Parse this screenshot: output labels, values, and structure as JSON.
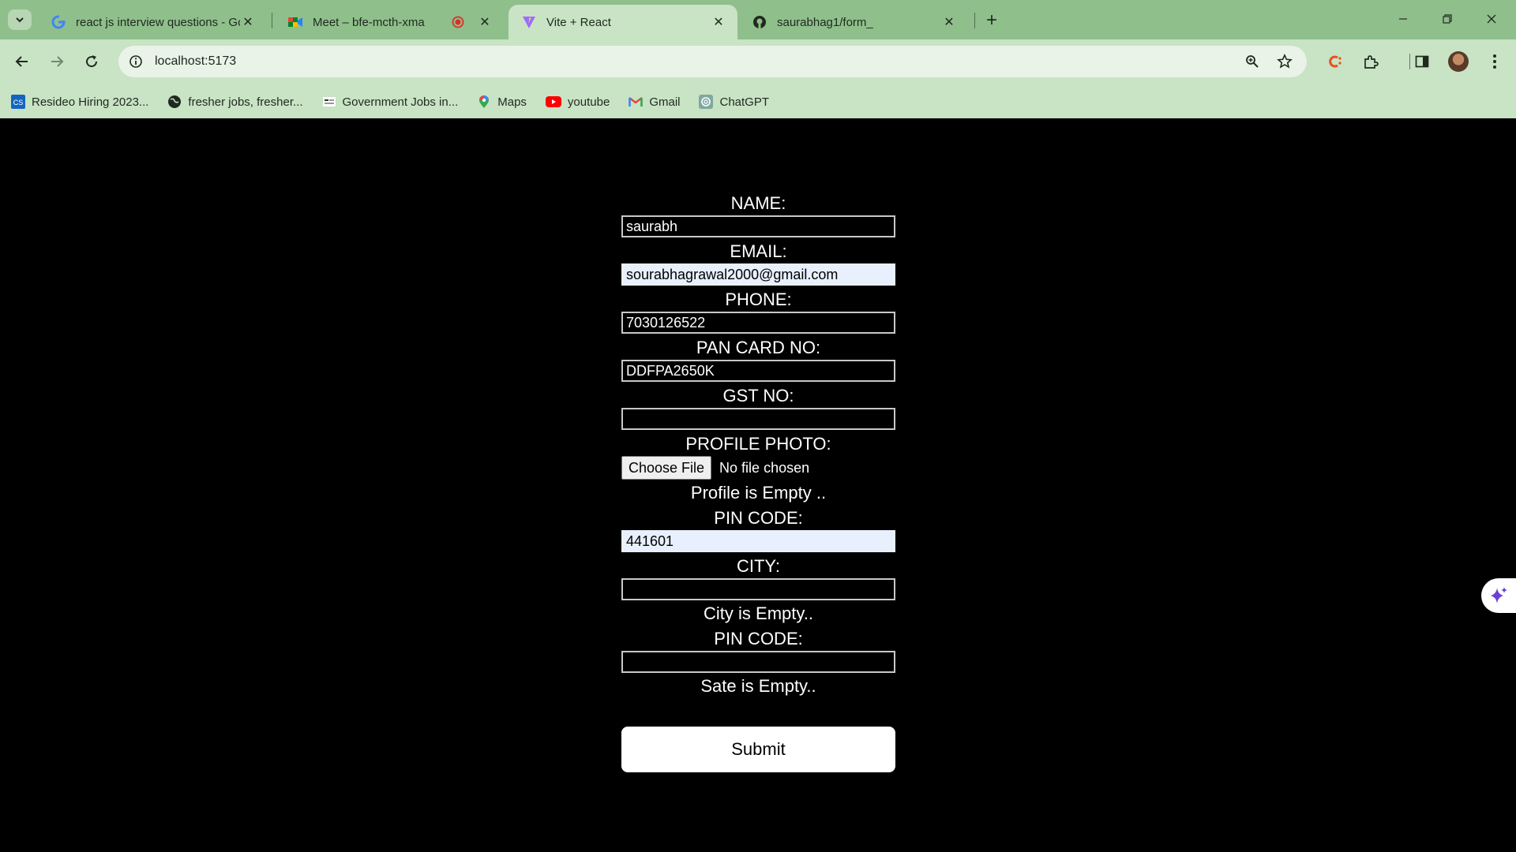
{
  "browser": {
    "tabs": [
      {
        "title": "react js interview questions - Go",
        "icon": "google-icon"
      },
      {
        "title": "Meet – bfe-mcth-xma",
        "icon": "meet-icon"
      },
      {
        "title": "Vite + React",
        "icon": "vite-icon",
        "active": true
      },
      {
        "title": "saurabhag1/form_",
        "icon": "github-icon"
      }
    ],
    "url": "localhost:5173",
    "bookmarks": [
      {
        "label": "Resideo Hiring 2023...",
        "icon": "cs-icon"
      },
      {
        "label": "fresher jobs, fresher...",
        "icon": "globe-icon"
      },
      {
        "label": "Government Jobs in...",
        "icon": "govt-icon"
      },
      {
        "label": "Maps",
        "icon": "maps-icon"
      },
      {
        "label": "youtube",
        "icon": "youtube-icon"
      },
      {
        "label": "Gmail",
        "icon": "gmail-icon"
      },
      {
        "label": "ChatGPT",
        "icon": "chatgpt-icon"
      }
    ]
  },
  "form": {
    "name_label": "NAME:",
    "name_value": "saurabh",
    "email_label": "EMAIL:",
    "email_value": "sourabhagrawal2000@gmail.com",
    "phone_label": "PHONE:",
    "phone_value": "7030126522",
    "pan_label": "PAN CARD NO:",
    "pan_value": "DDFPA2650K",
    "gst_label": "GST NO:",
    "gst_value": "",
    "photo_label": "PROFILE PHOTO:",
    "choose_file": "Choose File",
    "no_file": "No file chosen",
    "profile_error": "Profile is Empty ..",
    "pin_label": "PIN CODE:",
    "pin_value": "441601",
    "city_label": "CITY:",
    "city_value": "",
    "city_error": "City is Empty..",
    "pin2_label": "PIN CODE:",
    "pin2_value": "",
    "state_error": "Sate is Empty..",
    "submit": "Submit"
  },
  "colors": {
    "chrome": "#8fbf8b",
    "toolbar": "#c9e3c5",
    "page_bg": "#000000",
    "autofill_bg": "#e8f0fe"
  }
}
